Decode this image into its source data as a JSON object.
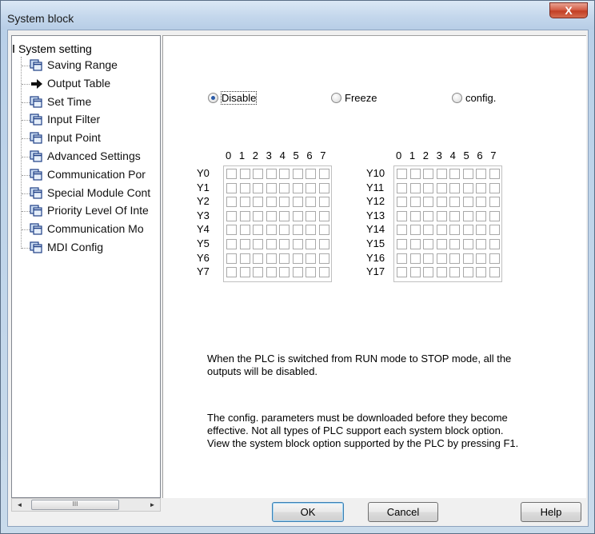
{
  "window": {
    "title": "System block",
    "close_glyph": "X"
  },
  "tree": {
    "root": "System setting",
    "items": [
      {
        "label": "Saving Range",
        "icon": "page-icon"
      },
      {
        "label": "Output Table",
        "icon": "arrow-right-icon"
      },
      {
        "label": "Set Time",
        "icon": "page-icon"
      },
      {
        "label": "Input Filter",
        "icon": "page-icon"
      },
      {
        "label": "Input Point",
        "icon": "page-icon"
      },
      {
        "label": "Advanced Settings",
        "icon": "page-icon"
      },
      {
        "label": "Communication Por",
        "icon": "page-icon"
      },
      {
        "label": "Special Module Cont",
        "icon": "page-icon"
      },
      {
        "label": "Priority Level Of Inte",
        "icon": "page-icon"
      },
      {
        "label": "Communication Mo",
        "icon": "page-icon"
      },
      {
        "label": "MDI Config",
        "icon": "page-icon"
      }
    ],
    "scroll_thumb_glyph": "III",
    "scroll_left": "◄",
    "scroll_right": "►"
  },
  "mode": {
    "options": [
      "Disable",
      "Freeze",
      "config."
    ],
    "selected": "Disable"
  },
  "table_left": {
    "bits": [
      "0",
      "1",
      "2",
      "3",
      "4",
      "5",
      "6",
      "7"
    ],
    "rows": [
      "Y0",
      "Y1",
      "Y2",
      "Y3",
      "Y4",
      "Y5",
      "Y6",
      "Y7"
    ]
  },
  "table_right": {
    "bits": [
      "0",
      "1",
      "2",
      "3",
      "4",
      "5",
      "6",
      "7"
    ],
    "rows": [
      "Y10",
      "Y11",
      "Y12",
      "Y13",
      "Y14",
      "Y15",
      "Y16",
      "Y17"
    ]
  },
  "info": {
    "line1": "When the PLC is switched from RUN mode to STOP mode, all the",
    "line2": "outputs will be disabled.",
    "note1": "The config. parameters must be downloaded before they become",
    "note2": "effective. Not all types of PLC support each system block option.",
    "note3": "View the system block option supported by the PLC by pressing F1."
  },
  "buttons": {
    "ok": "OK",
    "cancel": "Cancel",
    "help": "Help"
  }
}
